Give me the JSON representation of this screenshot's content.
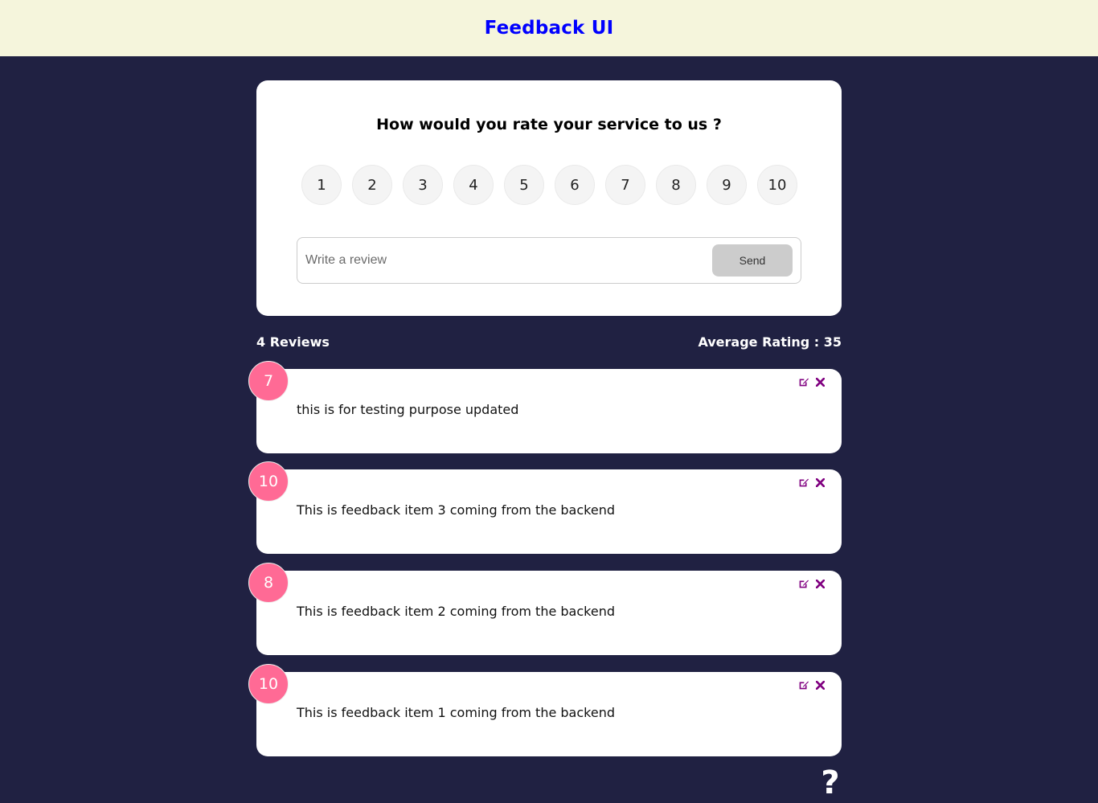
{
  "header": {
    "title": "Feedback UI"
  },
  "rating_card": {
    "question": "How would you rate your service to us ?",
    "options": [
      "1",
      "2",
      "3",
      "4",
      "5",
      "6",
      "7",
      "8",
      "9",
      "10"
    ],
    "review_placeholder": "Write a review",
    "send_label": "Send"
  },
  "stats": {
    "reviews_label": "4 Reviews",
    "average_label": "Average Rating : 35"
  },
  "feedback": [
    {
      "rating": "7",
      "text": "this is for testing purpose updated"
    },
    {
      "rating": "10",
      "text": "This is feedback item 3 coming from the backend"
    },
    {
      "rating": "8",
      "text": "This is feedback item 2 coming from the backend"
    },
    {
      "rating": "10",
      "text": "This is feedback item 1 coming from the backend"
    }
  ],
  "icons": {
    "edit": "edit-icon",
    "delete": "close-icon",
    "help": "question-icon"
  },
  "help": {
    "glyph": "?"
  },
  "colors": {
    "background": "#202142",
    "header_bg": "#f5f5dc",
    "title": "#0000ff",
    "rating_badge": "#ff6a95",
    "action_icon": "#800080"
  }
}
